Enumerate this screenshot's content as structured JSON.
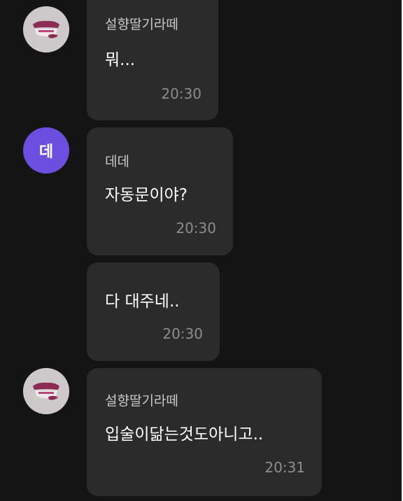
{
  "messages": [
    {
      "sender": "설향딸기라떼",
      "text": "뭐...",
      "time": "20:30",
      "avatar": "strawberry-logo-icon"
    },
    {
      "sender": "데데",
      "text": "자동문이야?",
      "time": "20:30",
      "avatar_initial": "데"
    },
    {
      "sender": "",
      "text": "다 대주네..",
      "time": "20:30"
    },
    {
      "sender": "설향딸기라떼",
      "text": "입술이닮는것도아니고..",
      "time": "20:31",
      "avatar": "strawberry-logo-icon"
    }
  ],
  "colors": {
    "background": "#141414",
    "bubble": "#2b2b2b",
    "avatar_initial_bg": "#6d4fe0",
    "avatar_photo_bg": "#c9c4c5"
  }
}
